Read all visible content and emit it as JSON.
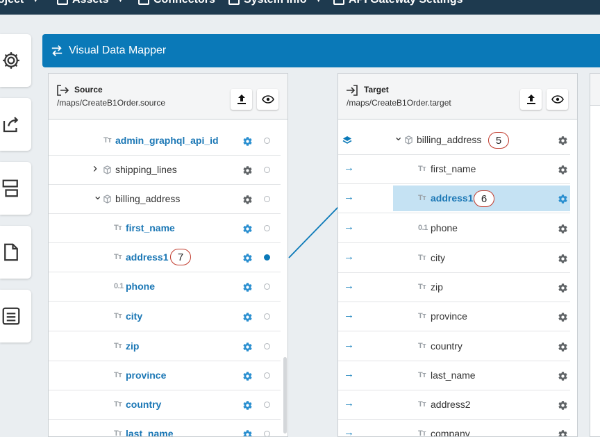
{
  "nav": {
    "items": [
      {
        "label": "Project",
        "icon": "folder-icon"
      },
      {
        "label": "Assets",
        "icon": "assets-icon"
      },
      {
        "label": "Connectors",
        "icon": "connectors-icon"
      },
      {
        "label": "System Info",
        "icon": "monitor-icon"
      },
      {
        "label": "API Gateway Settings",
        "icon": "gateway-icon"
      }
    ]
  },
  "header": {
    "title": "Visual Data Mapper"
  },
  "source": {
    "title": "Source",
    "path": "/maps/CreateB1Order.source",
    "rows": [
      {
        "label": "admin_graphql_api_id",
        "type": "Tт"
      },
      {
        "label": "shipping_lines",
        "type": "object"
      },
      {
        "label": "billing_address",
        "type": "object"
      },
      {
        "label": "first_name",
        "type": "Tт"
      },
      {
        "label": "address1",
        "type": "Tт",
        "callout": "7"
      },
      {
        "label": "phone",
        "type": "0.1"
      },
      {
        "label": "city",
        "type": "Tт"
      },
      {
        "label": "zip",
        "type": "Tт"
      },
      {
        "label": "province",
        "type": "Tт"
      },
      {
        "label": "country",
        "type": "Tт"
      },
      {
        "label": "last_name",
        "type": "Tт"
      }
    ]
  },
  "target": {
    "title": "Target",
    "path": "/maps/CreateB1Order.target",
    "rows": [
      {
        "label": "billing_address",
        "type": "object",
        "callout": "5"
      },
      {
        "label": "first_name",
        "type": "Tт"
      },
      {
        "label": "address1",
        "type": "Tт",
        "callout": "6"
      },
      {
        "label": "phone",
        "type": "0.1"
      },
      {
        "label": "city",
        "type": "Tт"
      },
      {
        "label": "zip",
        "type": "Tт"
      },
      {
        "label": "province",
        "type": "Tт"
      },
      {
        "label": "country",
        "type": "Tт"
      },
      {
        "label": "last_name",
        "type": "Tт"
      },
      {
        "label": "address2",
        "type": "Tт"
      },
      {
        "label": "company",
        "type": "Tт"
      }
    ]
  },
  "colors": {
    "accent": "#0a79b8",
    "selected": "#c5e2f3",
    "nav_bg": "#1e3a4f"
  }
}
